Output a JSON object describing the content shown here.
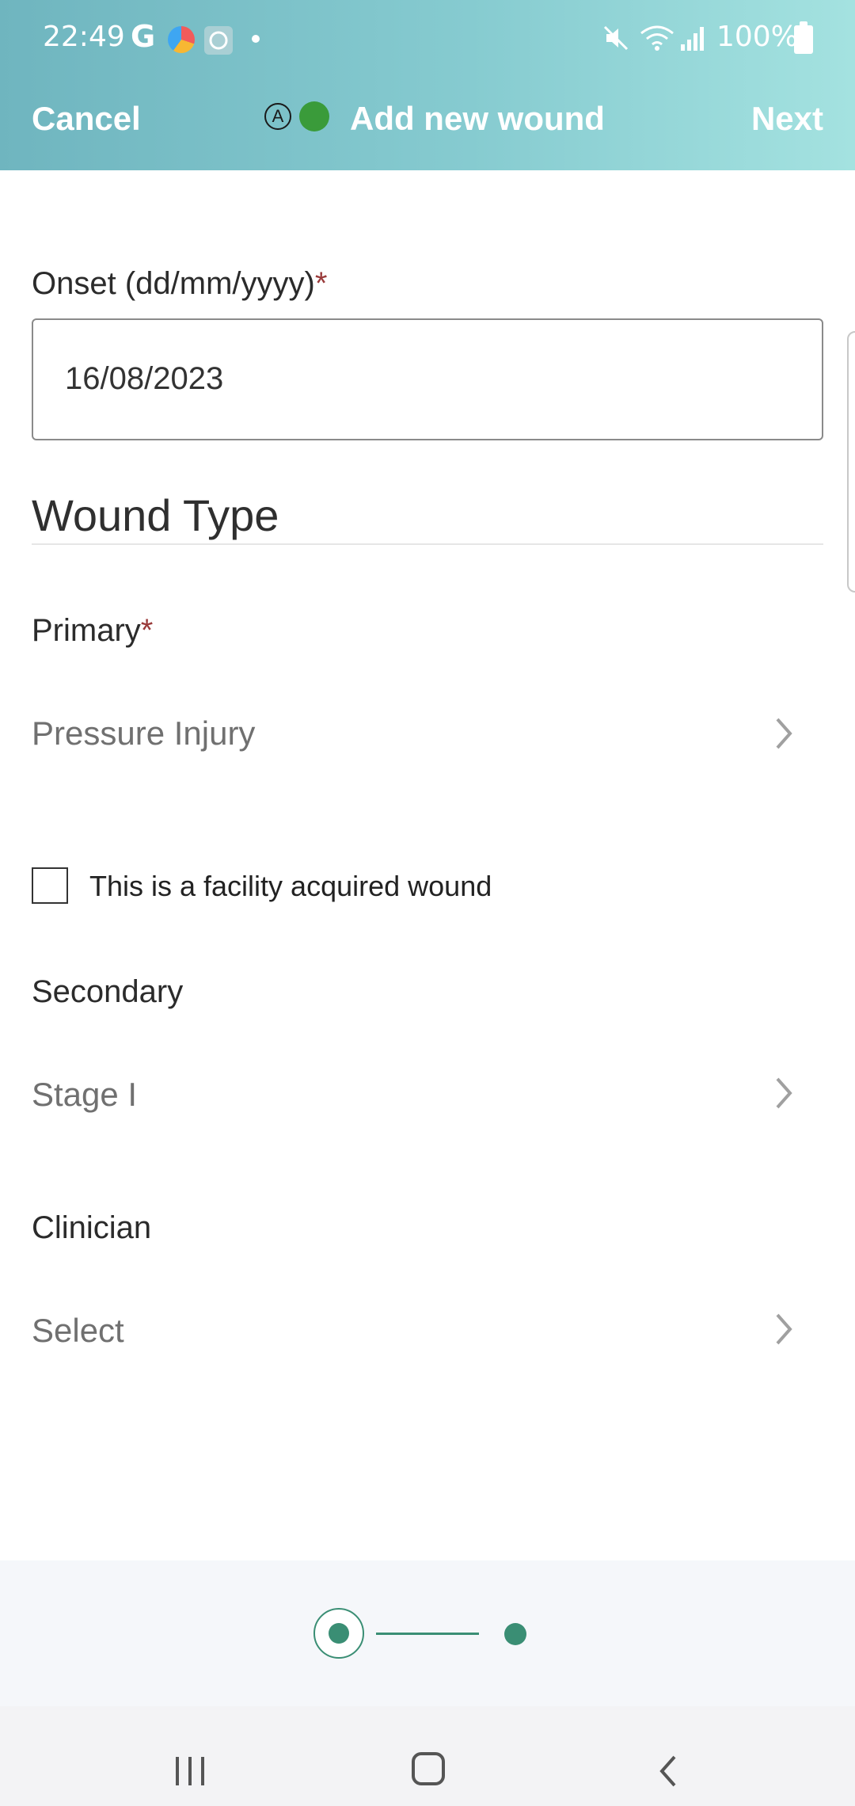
{
  "status_bar": {
    "time": "22:49",
    "g_label": "G",
    "battery": "100%"
  },
  "nav": {
    "cancel": "Cancel",
    "badge": "A",
    "title": "Add new wound",
    "next": "Next"
  },
  "form": {
    "onset_label": "Onset (dd/mm/yyyy)",
    "onset_required": "*",
    "onset_value": "16/08/2023",
    "section_title": "Wound Type",
    "primary_label": "Primary",
    "primary_required": "*",
    "primary_value": "Pressure Injury",
    "facility_checkbox_label": "This is a facility acquired wound",
    "secondary_label": "Secondary",
    "secondary_value": "Stage I",
    "clinician_label": "Clinician",
    "clinician_value": "Select"
  },
  "stepper": {
    "current_step": 1,
    "total_steps": 2,
    "accent_color": "#3a8e74"
  },
  "icons": {
    "chevron": "chevron-right-icon",
    "recent": "recent-apps-icon",
    "home": "home-icon",
    "back": "back-icon"
  }
}
